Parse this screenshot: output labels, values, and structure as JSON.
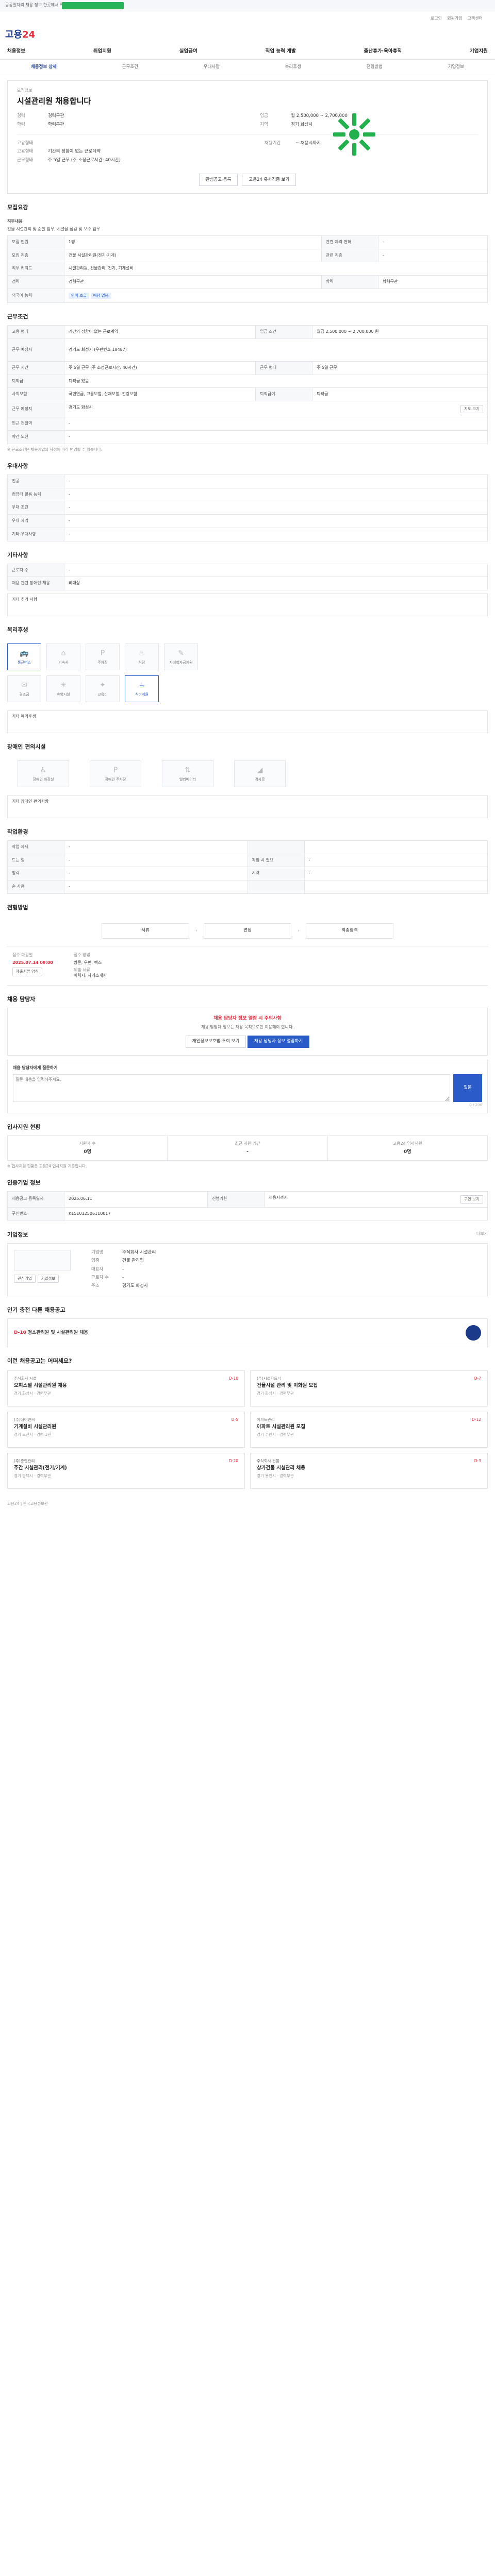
{
  "banner": {
    "text": "공공일자리 채용 정보 한곳에서 확인해보세요."
  },
  "util": [
    "로그인",
    "회원가입",
    "고객센터"
  ],
  "brand": {
    "name_a": "고용",
    "name_b": "24"
  },
  "nav": [
    "채용정보",
    "취업지원",
    "실업급여",
    "직업 능력 개발",
    "출산휴가·육아휴직",
    "기업지원"
  ],
  "subnav": [
    "채용정보 상세",
    "근무조건",
    "우대사항",
    "복리후생",
    "전형방법",
    "기업정보"
  ],
  "job": {
    "info_label": "모집정보",
    "title": "시설관리원 채용합니다",
    "left": [
      {
        "k": "경력",
        "v": "경력무관"
      },
      {
        "k": "학력",
        "v": "학력무관"
      }
    ],
    "right": [
      {
        "k": "임금",
        "v": "월 2,500,000 ~ 2,700,000"
      },
      {
        "k": "지역",
        "v": "경기 화성시"
      }
    ],
    "emp_label": "고용형태",
    "emp_value": "기간의 정함이 없는 근로계약",
    "work_label": "근무형태",
    "work_value": "주 5일 근무 (주 소정근로시간: 40시간)",
    "period_label": "채용기간",
    "period_value": "~ 채용시까지",
    "btn_interest": "관심공고 등록",
    "btn_similar": "고용24 유사직종 보기"
  },
  "recruit": {
    "title": "모집요강",
    "duty_label": "직무내용",
    "duty": "건물 시설관리 및 순찰 업무, 시설물 점검 및 보수 업무",
    "rows": [
      {
        "h1": "모집 인원",
        "v1": "1명",
        "h2": "관련 자격 면허",
        "v2": "-"
      },
      {
        "h1": "모집 직종",
        "v1": "건물 시설관리원(전기·기계)",
        "h2": "관련 직종",
        "v2": "-"
      },
      {
        "h1": "직무 키워드",
        "v1": "시설관리원, 건물관리, 전기, 기계설비",
        "h2": "",
        "v2": ""
      },
      {
        "h1": "경력",
        "v1": "경력무관",
        "h2": "학력",
        "v2": "학력무관"
      },
      {
        "h1": "외국어 능력",
        "v1": "-",
        "h2": "",
        "v2": ""
      }
    ],
    "lang_items": [
      "영어 초급",
      "해당 없음"
    ]
  },
  "cond": {
    "title": "근무조건",
    "rows": [
      {
        "h": "고용 형태",
        "v": "기간의 정함이 없는 근로계약",
        "h2": "임금 조건",
        "v2": "월급 2,500,000 ~ 2,700,000 원"
      },
      {
        "h": "근무 예정지",
        "v": "경기도 화성시 (우편번호 18487)",
        "h2": "",
        "v2": ""
      },
      {
        "h": "근무 시간",
        "v": "주 5일 근무 (주 소정근로시간: 40시간)",
        "h2": "근무 형태",
        "v2": "주 5일 근무"
      },
      {
        "h": "퇴직금",
        "v": "퇴직금 있음",
        "h2": "",
        "v2": ""
      },
      {
        "h": "사회보험",
        "v": "국민연금, 고용보험, 산재보험, 건강보험",
        "h2": "퇴직급여",
        "v2": "퇴직금"
      },
      {
        "h": "근무 예정지",
        "v": "경기도 화성시",
        "h2": "지도 보기",
        "v2": ""
      },
      {
        "h": "인근 전철역",
        "v": "-",
        "h2": "",
        "v2": ""
      },
      {
        "h": "야간 노선",
        "v": "-",
        "h2": "",
        "v2": ""
      }
    ],
    "note": "※ 근로조건은 채용기업의 사정에 따라 변경될 수 있습니다."
  },
  "pref": {
    "title": "우대사항",
    "rows": [
      {
        "h": "전공",
        "v": "-"
      },
      {
        "h": "컴퓨터 활용 능력",
        "v": "-"
      },
      {
        "h": "우대 조건",
        "v": "-"
      },
      {
        "h": "우대 자격",
        "v": "-"
      },
      {
        "h": "기타 우대사항",
        "v": "-"
      }
    ]
  },
  "etc": {
    "title": "기타사항",
    "rows": [
      {
        "h": "근로자 수",
        "v": "-"
      },
      {
        "h": "채용 관련 장애인 채용",
        "v": "비대상"
      }
    ],
    "note_title": "기타 추가 사항"
  },
  "welfare": {
    "title": "복리후생",
    "icons": [
      {
        "n": "통근버스",
        "on": true
      },
      {
        "n": "기숙사",
        "on": false
      },
      {
        "n": "주차장",
        "on": false
      },
      {
        "n": "식당",
        "on": false
      },
      {
        "n": "자녀학자금지원",
        "on": false
      },
      {
        "n": "경조금",
        "on": false
      },
      {
        "n": "휴양시설",
        "on": false
      },
      {
        "n": "교육비",
        "on": false
      },
      {
        "n": "식비지원",
        "on": false
      }
    ],
    "etc_label": "기타 복리후생"
  },
  "facility": {
    "title": "장애인 편의시설",
    "icons": [
      "장애인 화장실",
      "장애인 주차장",
      "엘리베이터",
      "경사로"
    ],
    "etc_label": "기타 장애인 편의사항"
  },
  "env": {
    "title": "작업환경",
    "rows": [
      {
        "h1": "작업 자세",
        "v1": "-",
        "h2": "",
        "v2": ""
      },
      {
        "h1": "드는 힘",
        "v1": "-",
        "h2": "작업 시 필요",
        "v2": "-"
      },
      {
        "h1": "청각",
        "v1": "-",
        "h2": "시력",
        "v2": "-"
      },
      {
        "h1": "손 사용",
        "v1": "-",
        "h2": "",
        "v2": ""
      }
    ]
  },
  "select": {
    "title": "전형방법",
    "steps": [
      "서류",
      "면접",
      "최종합격"
    ],
    "date_label": "접수 마감일",
    "date": "2025.07.14 09:00",
    "method_label": "접수 방법",
    "method": "방문, 우편, 팩스",
    "doc_label": "제출 서류",
    "doc": "이력서, 자기소개서",
    "btn_form": "제출서류 양식"
  },
  "contact": {
    "title": "채용 담당자",
    "warn": "채용 담당자 정보 열람 시 주의사항",
    "desc": "채용 담당자 정보는 채용 목적으로만 이용해야 합니다.",
    "btn_a": "개인정보보호법 조회 보기",
    "btn_b": "채용 담당자 정보 열람하기",
    "ask_label": "채용 담당자에게 질문하기",
    "placeholder": "질문 내용을 입력해주세요.",
    "count": "0 / 200",
    "submit": "질문"
  },
  "stats": {
    "title": "입사지원 현황",
    "items": [
      {
        "k": "지원자 수",
        "v": "0명"
      },
      {
        "k": "최근 지원 기간",
        "v": "-"
      },
      {
        "k": "고용24 입사지원",
        "v": "0명"
      }
    ],
    "note": "※ 입사지원 현황은 고용24 입사지원 기준입니다."
  },
  "mgmt": {
    "title": "인증기업 정보",
    "rows": [
      {
        "h1": "채용공고 등록일시",
        "v1": "2025.06.11",
        "h2": "진행기한",
        "v2": "채용시까지"
      },
      {
        "h1": "구인번호",
        "v1": "K151012506110017",
        "h2": "",
        "v2": ""
      }
    ],
    "btn": "구인 보기"
  },
  "company": {
    "title": "기업정보",
    "more": "더보기",
    "rows": [
      {
        "k": "기업명",
        "v": "주식회사 시설관리"
      },
      {
        "k": "업종",
        "v": "건물 관리업"
      },
      {
        "k": "대표자",
        "v": "-"
      },
      {
        "k": "근로자 수",
        "v": "-"
      },
      {
        "k": "주소",
        "v": "경기도 화성시"
      }
    ],
    "btn1": "관심기업",
    "btn2": "기업정보"
  },
  "recent": {
    "title": "인기 충전 다른 채용공고",
    "dday": "D-10",
    "item": "청소관리원 및 시설관리원 채용"
  },
  "rec": {
    "title": "이런 채용공고는 어떠세요?",
    "items": [
      {
        "org": "주식회사 시설",
        "t": "오피스텔 시설관리원 채용",
        "m": "경기 화성시 · 경력무관",
        "d": "D-10"
      },
      {
        "org": "(주)시설파트너",
        "t": "건물시설 관리 및 미화원 모집",
        "m": "경기 화성시 · 경력무관",
        "d": "D-7"
      },
      {
        "org": "(주)에이앤씨",
        "t": "기계설비 시설관리원",
        "m": "경기 오산시 · 경력 1년",
        "d": "D-5"
      },
      {
        "org": "아파트관리",
        "t": "아파트 시설관리원 모집",
        "m": "경기 수원시 · 경력무관",
        "d": "D-12"
      },
      {
        "org": "(주)종합관리",
        "t": "주간 시설관리(전기/기계)",
        "m": "경기 평택시 · 경력무관",
        "d": "D-20"
      },
      {
        "org": "주식회사 건물",
        "t": "상가건물 시설관리 채용",
        "m": "경기 용인시 · 경력무관",
        "d": "D-3"
      }
    ]
  },
  "footer": {
    "text": "고용24 | 한국고용정보원"
  }
}
